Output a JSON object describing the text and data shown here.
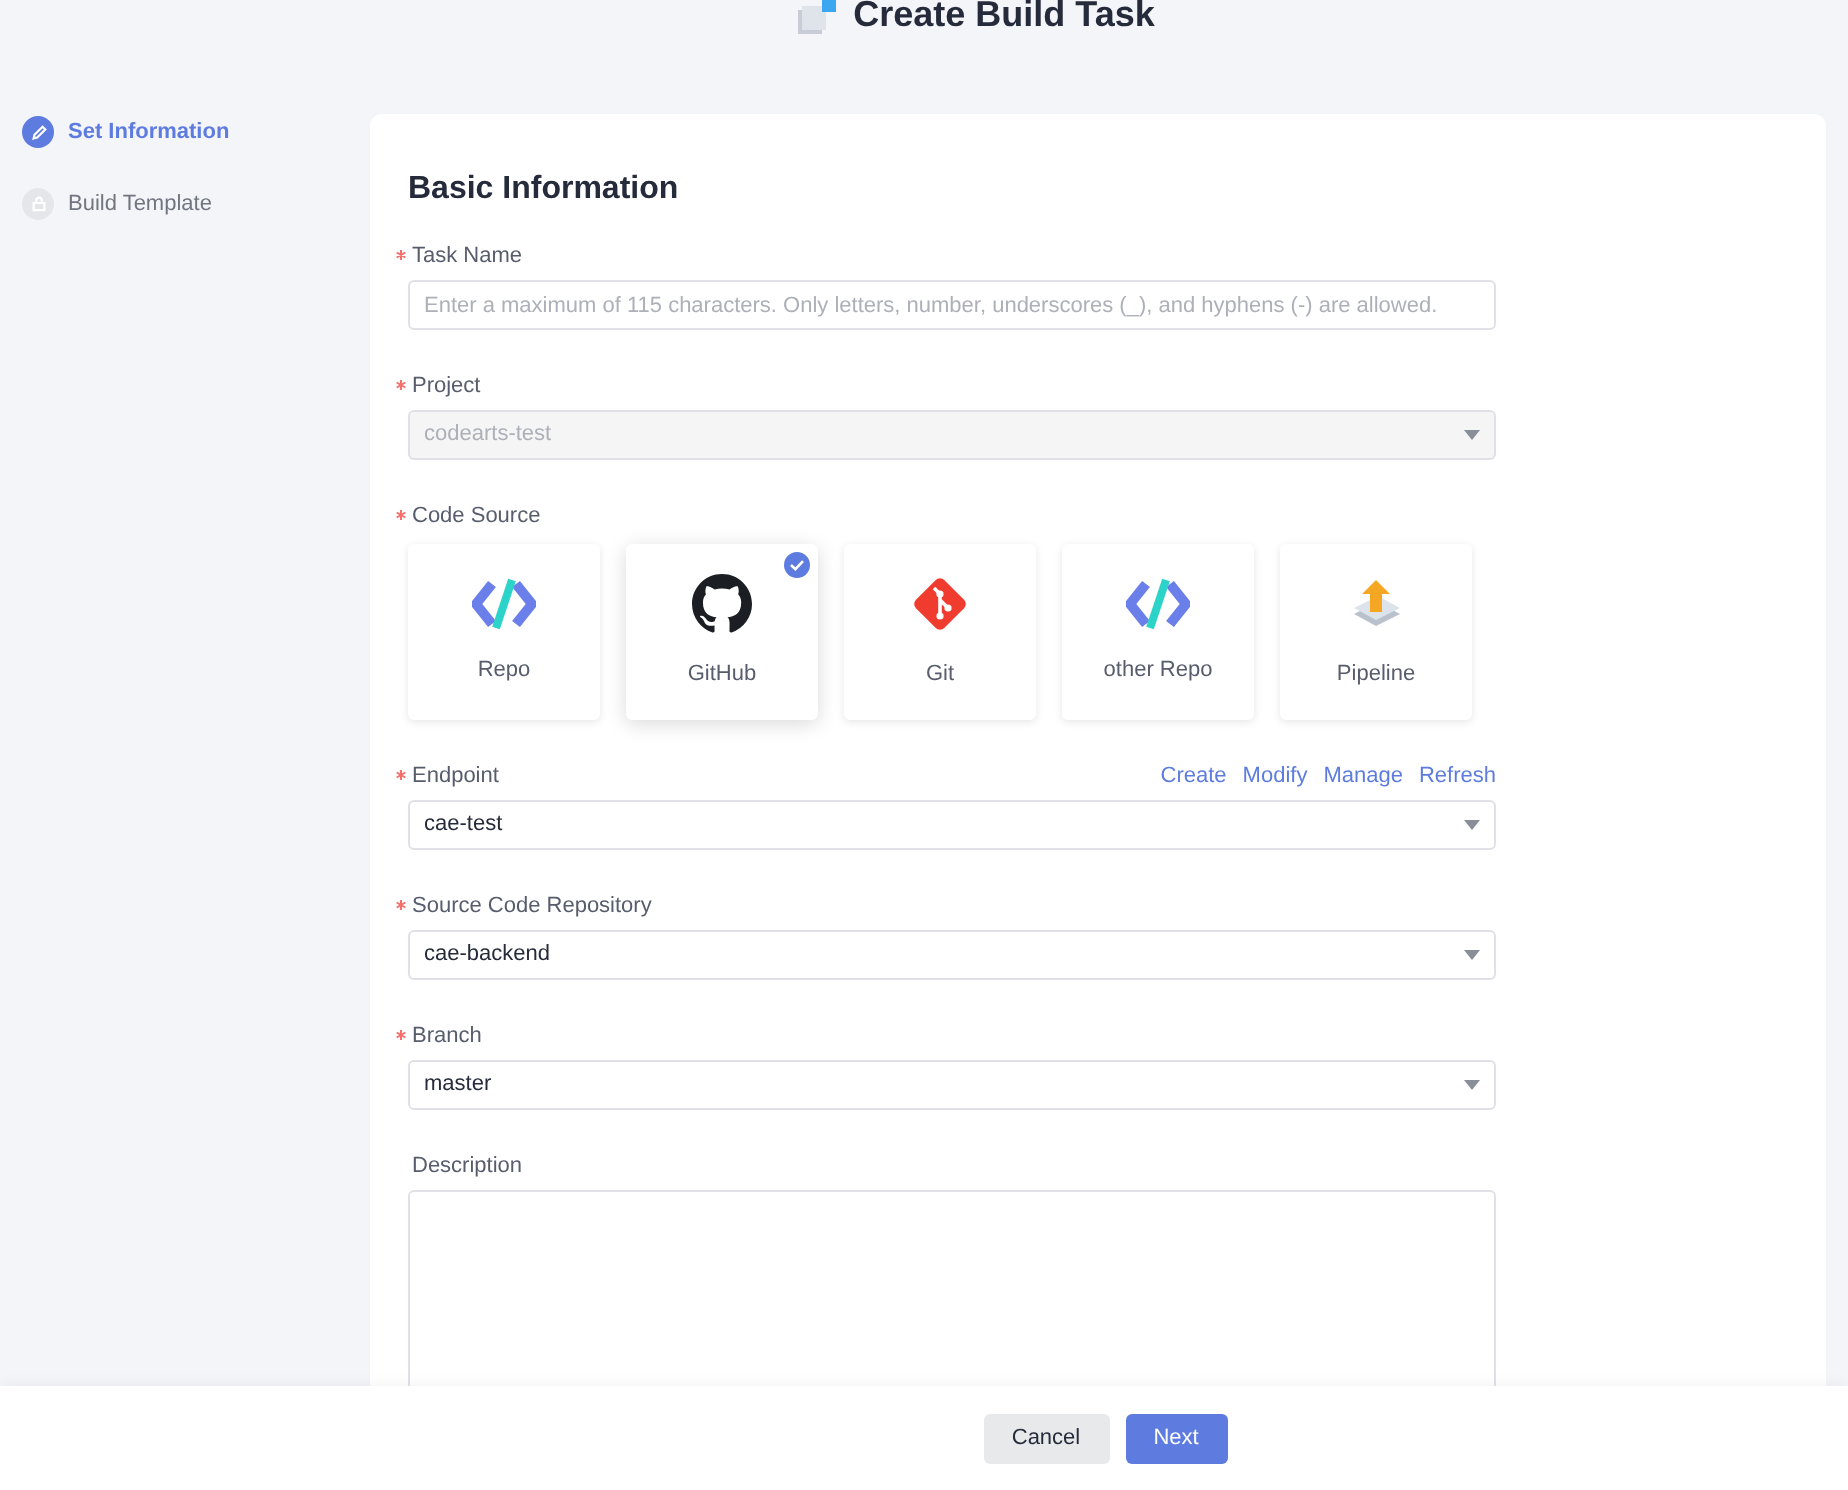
{
  "title": "Create Build Task",
  "steps": [
    {
      "label": "Set Information",
      "selected": true
    },
    {
      "label": "Build Template",
      "selected": false
    }
  ],
  "section_title": "Basic Information",
  "fields": [
    {
      "kind": "text",
      "label": "Task Name",
      "required": true,
      "placeholder": "Enter a maximum of 115 characters. Only letters, number, underscores (_), and hyphens (-) are allowed."
    },
    {
      "kind": "select",
      "label": "Project",
      "required": true,
      "value": "codearts-test",
      "disabled": true
    },
    {
      "kind": "sources",
      "label": "Code Source",
      "required": true,
      "options": [
        {
          "label": "Repo",
          "kind": "repo",
          "selected": false
        },
        {
          "label": "GitHub",
          "kind": "github",
          "selected": true
        },
        {
          "label": "Git",
          "kind": "git",
          "selected": false
        },
        {
          "label": "other Repo",
          "kind": "repo",
          "selected": false
        },
        {
          "label": "Pipeline",
          "kind": "pipeline",
          "selected": false
        }
      ]
    },
    {
      "kind": "select",
      "label": "Endpoint",
      "required": true,
      "value": "cae-test",
      "disabled": false,
      "links": [
        "Create",
        "Modify",
        "Manage",
        "Refresh"
      ]
    },
    {
      "kind": "select",
      "label": "Source Code Repository",
      "required": true,
      "value": "cae-backend",
      "disabled": false
    },
    {
      "kind": "select",
      "label": "Branch",
      "required": true,
      "value": "master",
      "disabled": false
    },
    {
      "kind": "textarea",
      "label": "Description",
      "required": false
    }
  ],
  "buttons": [
    {
      "label": "Cancel",
      "kind": "secondary"
    },
    {
      "label": "Next",
      "kind": "primary"
    }
  ]
}
